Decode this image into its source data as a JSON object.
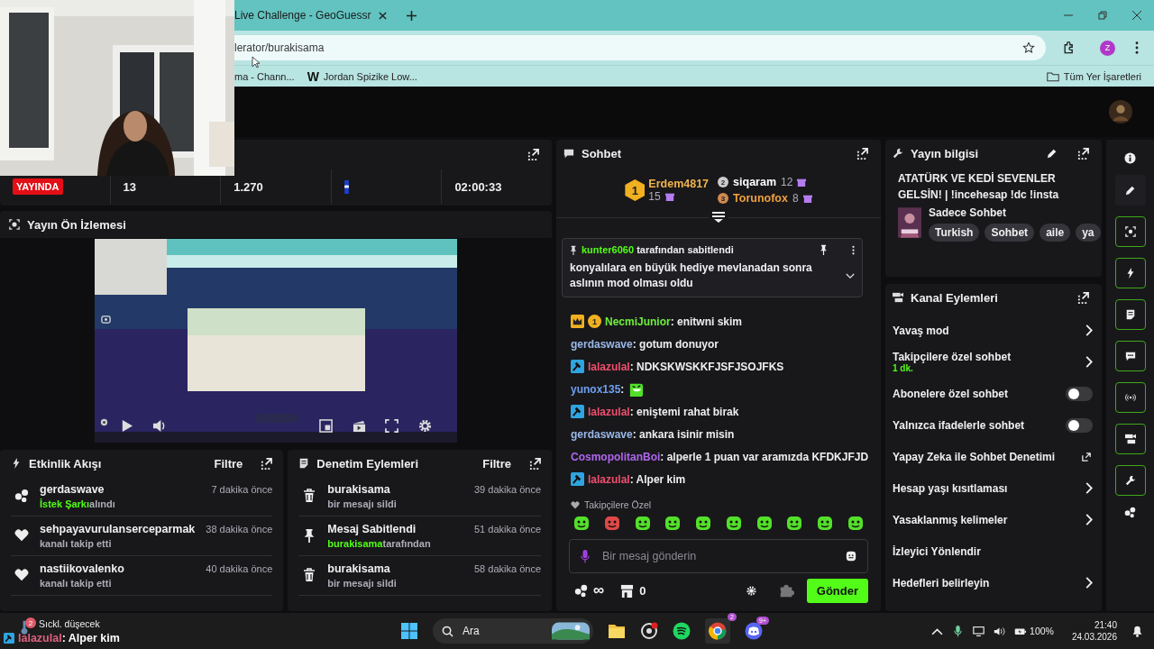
{
  "browser": {
    "tab_title": "Live Challenge - GeoGuessr",
    "address": "lerator/burakisama",
    "profile_initial": "Z",
    "bookmarks": [
      {
        "label": "ma - Chann..."
      },
      {
        "label": "Jordan Spizike Low...",
        "icon_letter": "W"
      }
    ],
    "all_bookmarks": "Tüm Yer İşaretleri"
  },
  "stats": {
    "live_badge": "YAYINDA",
    "viewers": "13",
    "followers": "1.270",
    "uptime": "02:00:33"
  },
  "preview": {
    "title": "Yayın Ön İzlemesi"
  },
  "activity": {
    "title": "Etkinlik Akışı",
    "filter": "Filtre",
    "items": [
      {
        "kind": "redeem",
        "user": "gerdaswave",
        "highlight": "İstek Şarkı",
        "detail": "alındı",
        "time": "7 dakika önce"
      },
      {
        "kind": "follow",
        "user": "sehpayavurulanserceparmak",
        "detail": "kanalı takip etti",
        "time": "38 dakika önce"
      },
      {
        "kind": "follow",
        "user": "nastiikovalenko",
        "detail": "kanalı takip etti",
        "time": "40 dakika önce"
      }
    ]
  },
  "moderation": {
    "title": "Denetim Eylemleri",
    "filter": "Filtre",
    "items": [
      {
        "kind": "delete",
        "title": "burakisama",
        "detail": "bir mesajı sildi",
        "time": "39 dakika önce"
      },
      {
        "kind": "pin",
        "title": "Mesaj Sabitlendi",
        "highlight": "burakisama",
        "detail": "tarafından",
        "time": "51 dakika önce"
      },
      {
        "kind": "delete",
        "title": "burakisama",
        "detail": "bir mesajı sildi",
        "time": "58 dakika önce"
      }
    ]
  },
  "chat": {
    "title": "Sohbet",
    "leaders": [
      {
        "rank": "1",
        "name": "Erdem4817",
        "count": "15",
        "color": "#f0b44a"
      },
      {
        "rank": "2",
        "name": "siqaram",
        "count": "12",
        "color": "#ffffff"
      },
      {
        "rank": "3",
        "name": "Torunofox",
        "count": "8",
        "color": "#f0a040"
      }
    ],
    "pinned": {
      "by": "kunter6060",
      "suffix": "tarafından sabitlendi",
      "text": "konyalılara en büyük hediye mevlanadan sonra aslının mod olması oldu"
    },
    "messages": [
      {
        "kind": "text",
        "user": "NecmiJunior",
        "color": "#6ef03a",
        "badges": [
          {
            "kind": "crown"
          },
          {
            "kind": "coin",
            "label": "1"
          }
        ],
        "text": ": enitwni skim"
      },
      {
        "kind": "text",
        "user": "gerdaswave",
        "color": "#9ab8e8",
        "text": ": gotum donuyor"
      },
      {
        "kind": "text",
        "user": "lalazulal",
        "color": "#f0506e",
        "badges": [
          {
            "kind": "mod"
          }
        ],
        "text": ": NDKSKWSKKFJSFJSOJFKS"
      },
      {
        "kind": "emote",
        "user": "yunox135",
        "color": "#6fa0f0",
        "text": ":"
      },
      {
        "kind": "text",
        "user": "lalazulal",
        "color": "#f0506e",
        "badges": [
          {
            "kind": "mod"
          }
        ],
        "text": ": eniştemi rahat birak"
      },
      {
        "kind": "text",
        "user": "gerdaswave",
        "color": "#9ab8e8",
        "text": ": ankara isinir misin"
      },
      {
        "kind": "text",
        "user": "CosmopolitanBoi",
        "color": "#b066f0",
        "text": ": alperle 1 puan var aramızda KFDKJFJD"
      },
      {
        "kind": "text",
        "user": "lalazulal",
        "color": "#f0506e",
        "badges": [
          {
            "kind": "mod"
          }
        ],
        "text": ": Alper kim"
      }
    ],
    "emote_set": "Takipçilere Özel",
    "placeholder": "Bir mesaj gönderin",
    "points": "∞",
    "store_count": "0",
    "send": "Gönder"
  },
  "stream_info": {
    "title": "Yayın bilgisi",
    "stream_title": "ATATÜRK VE KEDİ SEVENLER GELSİN! | !incehesap !dc !insta",
    "category": "Sadece Sohbet",
    "tags": [
      "Turkish",
      "Sohbet",
      "aile",
      "ya"
    ]
  },
  "channel_actions": {
    "title": "Kanal Eylemleri",
    "items": [
      {
        "kind": "link",
        "label": "Yavaş mod"
      },
      {
        "kind": "link",
        "label": "Takipçilere özel sohbet",
        "sub": "1 dk."
      },
      {
        "kind": "toggle",
        "label": "Abonelere özel sohbet",
        "on": false
      },
      {
        "kind": "toggle",
        "label": "Yalnızca ifadelerle sohbet",
        "on": false
      },
      {
        "kind": "external",
        "label": "Yapay Zeka ile Sohbet Denetimi"
      },
      {
        "kind": "link",
        "label": "Hesap yaşı kısıtlaması"
      },
      {
        "kind": "link",
        "label": "Yasaklanmış kelimeler"
      },
      {
        "kind": "plain",
        "label": "İzleyici Yönlendir"
      },
      {
        "kind": "link",
        "label": "Hedefleri belirleyin"
      }
    ]
  },
  "overlay": {
    "chat_user": "lalazulal",
    "chat_text": ": Alper kim"
  },
  "taskbar": {
    "weather_badge": "2",
    "weather": "Sıckl. düşecek",
    "search": "Ara",
    "chrome_badge": "2",
    "discord_badge": "9+",
    "battery": "100%",
    "time": "21:40",
    "date": "24.03.2026"
  }
}
